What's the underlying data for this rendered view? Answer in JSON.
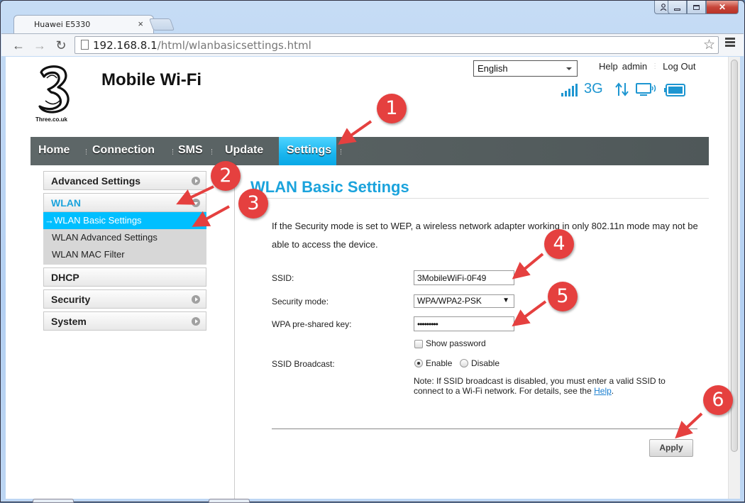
{
  "browser": {
    "tab_title": "Huawei E5330",
    "url_host": "192.168.8.1",
    "url_path": "/html/wlanbasicsettings.html",
    "icons": {
      "back": "arrow-left",
      "forward": "arrow-right",
      "reload": "reload",
      "bookmark": "star",
      "menu": "hamburger",
      "profile": "person",
      "minimize": "minimize",
      "maximize": "maximize",
      "close": "x"
    }
  },
  "header": {
    "logo_text": "Three.co.uk",
    "title": "Mobile Wi-Fi",
    "language": "English",
    "links": [
      "Help",
      "admin",
      "Log Out"
    ],
    "network_type": "3G",
    "signal_bars": 5,
    "status_icons": [
      "signal-icon",
      "network-type",
      "data-transfer-icon",
      "wifi-device-icon",
      "battery-icon"
    ],
    "accent_color": "#1e96d1"
  },
  "nav": {
    "items": [
      "Home",
      "Connection",
      "SMS",
      "Update",
      "Settings"
    ],
    "active": "Settings",
    "active_color": "#09a8e6"
  },
  "sidebar": {
    "items": [
      {
        "label": "Advanced Settings",
        "expandable": true
      },
      {
        "label": "WLAN",
        "expanded": true,
        "children": [
          "WLAN Basic Settings",
          "WLAN Advanced Settings",
          "WLAN MAC Filter"
        ],
        "active_child": "WLAN Basic Settings",
        "active_prefix": "→"
      },
      {
        "label": "DHCP",
        "expandable": false
      },
      {
        "label": "Security",
        "expandable": true
      },
      {
        "label": "System",
        "expandable": true
      }
    ]
  },
  "main": {
    "title": "WLAN Basic Settings",
    "intro": "If the Security mode is set to WEP, a wireless network adapter working in only 802.11n mode may not be able to access the device.",
    "ssid_label": "SSID:",
    "ssid_value": "3MobileWiFi-0F49",
    "security_label": "Security mode:",
    "security_value": "WPA/WPA2-PSK",
    "key_label": "WPA pre-shared key:",
    "key_value": "•••••••••",
    "show_password_label": "Show password",
    "show_password_checked": false,
    "broadcast_label": "SSID Broadcast:",
    "broadcast_options": [
      "Enable",
      "Disable"
    ],
    "broadcast_selected": "Enable",
    "note_text": "Note: If SSID broadcast is disabled, you must enter a valid SSID to connect to a Wi-Fi network. For details, see the ",
    "note_link": "Help",
    "note_end": ".",
    "apply_label": "Apply"
  },
  "annotations": {
    "steps": [
      "1",
      "2",
      "3",
      "4",
      "5",
      "6"
    ],
    "color": "#e5403f"
  }
}
